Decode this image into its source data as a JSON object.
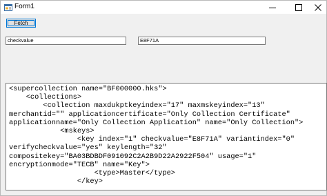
{
  "window": {
    "title": "Form1"
  },
  "icons": {
    "app": "form-icon",
    "minimize": "minimize-icon",
    "maximize": "maximize-icon",
    "close": "close-icon"
  },
  "form": {
    "fetch_label": "Fetch",
    "input_left_value": "checkvalue",
    "input_right_value": "E8F71A"
  },
  "xml_output": {
    "lines": [
      "<supercollection name=\"BF000000.hks\">",
      "    <collections>",
      "        <collection maxdukptkeyindex=\"17\" maxmskeyindex=\"13\"",
      "merchantid=\"\" applicationcertificate=\"Only Collection Certificate\"",
      "applicationname=\"Only Collection Application\" name=\"Only Collection\">",
      "            <mskeys>",
      "                <key index=\"1\" checkvalue=\"E8F71A\" variantindex=\"0\"",
      "verifycheckvalue=\"yes\" keylength=\"32\"",
      "compositekey=\"BA03BDBDF091092C2A2B9D22A2922F504\" usage=\"1\"",
      "encryptionmode=\"TECB\" name=\"Key\">",
      "                    <type>Master</type>",
      "                </key>"
    ]
  }
}
